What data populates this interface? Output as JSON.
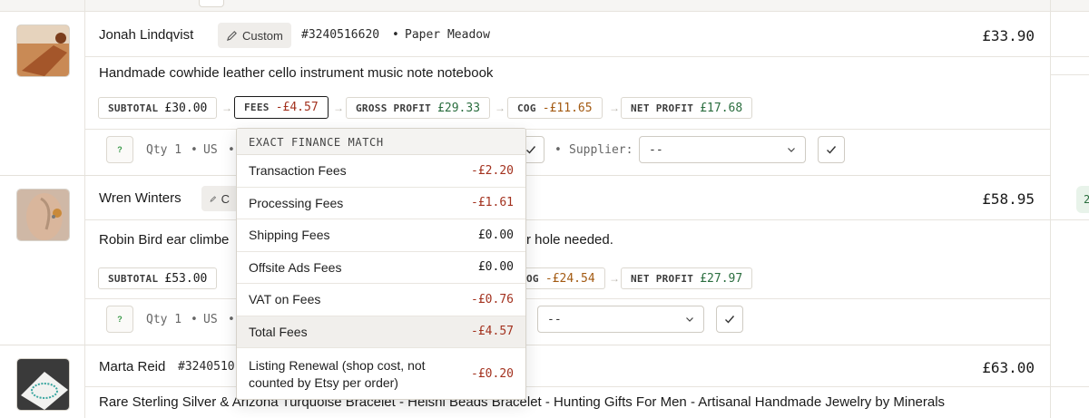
{
  "orders": [
    {
      "customer": "Jonah Lindqvist",
      "custom_label": "Custom",
      "order_number": "#3240516620",
      "shop": "Paper Meadow",
      "price": "£33.90",
      "title": "Handmade cowhide leather cello instrument music note notebook",
      "subtotal": {
        "label": "SUBTOTAL",
        "value": "£30.00"
      },
      "fees": {
        "label": "FEES",
        "value": "-£4.57"
      },
      "gross_profit": {
        "label": "GROSS PROFIT",
        "value": "£29.33"
      },
      "cog": {
        "label": "COG",
        "value": "-£11.65"
      },
      "net_profit": {
        "label": "NET PROFIT",
        "value": "£17.68"
      },
      "qty": "Qty 1",
      "country": "US",
      "supplier_label": "Supplier:",
      "supplier_value": "--"
    },
    {
      "customer": "Wren Winters",
      "custom_label": "C",
      "price": "£58.95",
      "title_start": "Robin Bird ear climbe",
      "title_end": "r hole needed.",
      "subtotal": {
        "label": "SUBTOTAL",
        "value": "£53.00"
      },
      "cog": {
        "label": "OG",
        "value": "-£24.54"
      },
      "net_profit": {
        "label": "NET PROFIT",
        "value": "£27.97"
      },
      "qty": "Qty 1",
      "country": "US",
      "supplier_value": "--"
    },
    {
      "customer": "Marta Reid",
      "order_number": "#3240510",
      "price": "£63.00",
      "title": "Rare Sterling Silver & Arizona Turquoise Bracelet - Heishi Beads Bracelet - Hunting Gifts For Men - Artisanal Handmade Jewelry by Minerals"
    }
  ],
  "side_chip": "2",
  "qty_badge": "?",
  "fees_dropdown": {
    "header": "EXACT FINANCE MATCH",
    "rows": [
      {
        "label": "Transaction Fees",
        "value": "-£2.20",
        "tone": "neg"
      },
      {
        "label": "Processing Fees",
        "value": "-£1.61",
        "tone": "neg"
      },
      {
        "label": "Shipping Fees",
        "value": "£0.00",
        "tone": "dark"
      },
      {
        "label": "Offsite Ads Fees",
        "value": "£0.00",
        "tone": "dark"
      },
      {
        "label": "VAT on Fees",
        "value": "-£0.76",
        "tone": "neg"
      },
      {
        "label": "Total Fees",
        "value": "-£4.57",
        "tone": "neg"
      },
      {
        "label": "Listing Renewal (shop cost, not counted by Etsy per order)",
        "value": "-£0.20",
        "tone": "neg"
      }
    ]
  },
  "colors": {
    "negative": "#a3321f",
    "positive": "#2b6e3f",
    "cog": "#a35a12"
  }
}
